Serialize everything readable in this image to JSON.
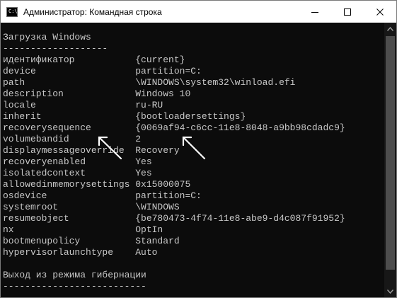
{
  "window": {
    "title": "Администратор: Командная строка",
    "icon_label": "C:\\",
    "controls": [
      "minimize-icon",
      "maximize-icon",
      "close-icon"
    ]
  },
  "console": {
    "lines": [
      "Загрузка Windows",
      "-------------------",
      "идентификатор           {current}",
      "device                  partition=C:",
      "path                    \\WINDOWS\\system32\\winload.efi",
      "description             Windows 10",
      "locale                  ru-RU",
      "inherit                 {bootloadersettings}",
      "recoverysequence        {0069af94-c6cc-11e8-8048-a9bb98cdadc9}",
      "volumebandid            2",
      "displaymessageoverride  Recovery",
      "recoveryenabled         Yes",
      "isolatedcontext         Yes",
      "allowedinmemorysettings 0x15000075",
      "osdevice                partition=C:",
      "systemroot              \\WINDOWS",
      "resumeobject            {be780473-4f74-11e8-abe9-d4c087f91952}",
      "nx                      OptIn",
      "bootmenupolicy          Standard",
      "hypervisorlaunchtype    Auto",
      "",
      "Выход из режима гибернации",
      "--------------------------"
    ]
  },
  "annotations": {
    "arrow_color": "#ffffff",
    "arrows": [
      "arrow-to-recoverysequence-label",
      "arrow-to-recoverysequence-value"
    ]
  }
}
